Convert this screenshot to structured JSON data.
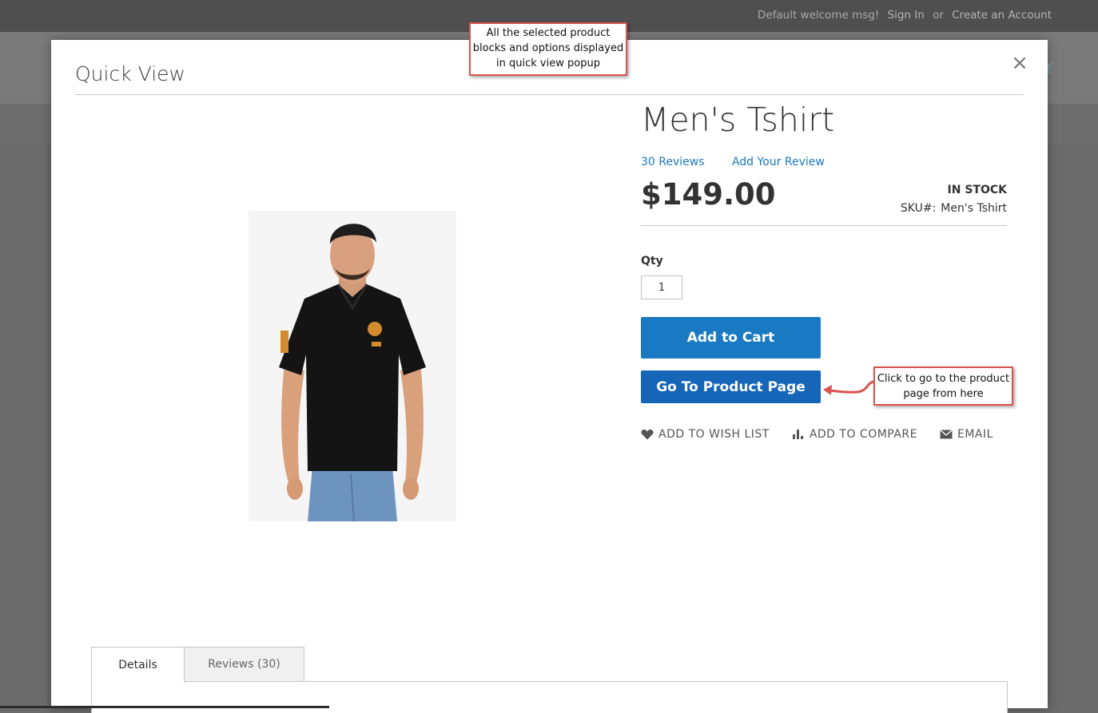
{
  "header": {
    "welcome": "Default welcome msg!",
    "sign_in": "Sign In",
    "or": "or",
    "create_account": "Create an Account"
  },
  "modal": {
    "title": "Quick View",
    "close_symbol": "×"
  },
  "product": {
    "name": "Men's Tshirt",
    "reviews_link": "30  Reviews",
    "add_review_link": "Add Your Review",
    "price": "$149.00",
    "stock_status": "IN STOCK",
    "sku_label": "SKU#:",
    "sku_value": "Men's Tshirt",
    "qty_label": "Qty",
    "qty_value": "1",
    "image_alt": "Men's black polo t-shirt"
  },
  "buttons": {
    "add_to_cart": "Add to Cart",
    "go_to_product": "Go To Product Page"
  },
  "actions": {
    "wishlist": "ADD TO WISH LIST",
    "compare": "ADD TO COMPARE",
    "email": "EMAIL"
  },
  "tabs": {
    "details": "Details",
    "reviews": "Reviews (30)"
  },
  "callouts": {
    "top": "All the selected product blocks and options displayed in quick view popup",
    "right": "Click to go to the product page from here"
  },
  "colors": {
    "accent": "#1979c3",
    "callout_border": "#d9534f"
  }
}
